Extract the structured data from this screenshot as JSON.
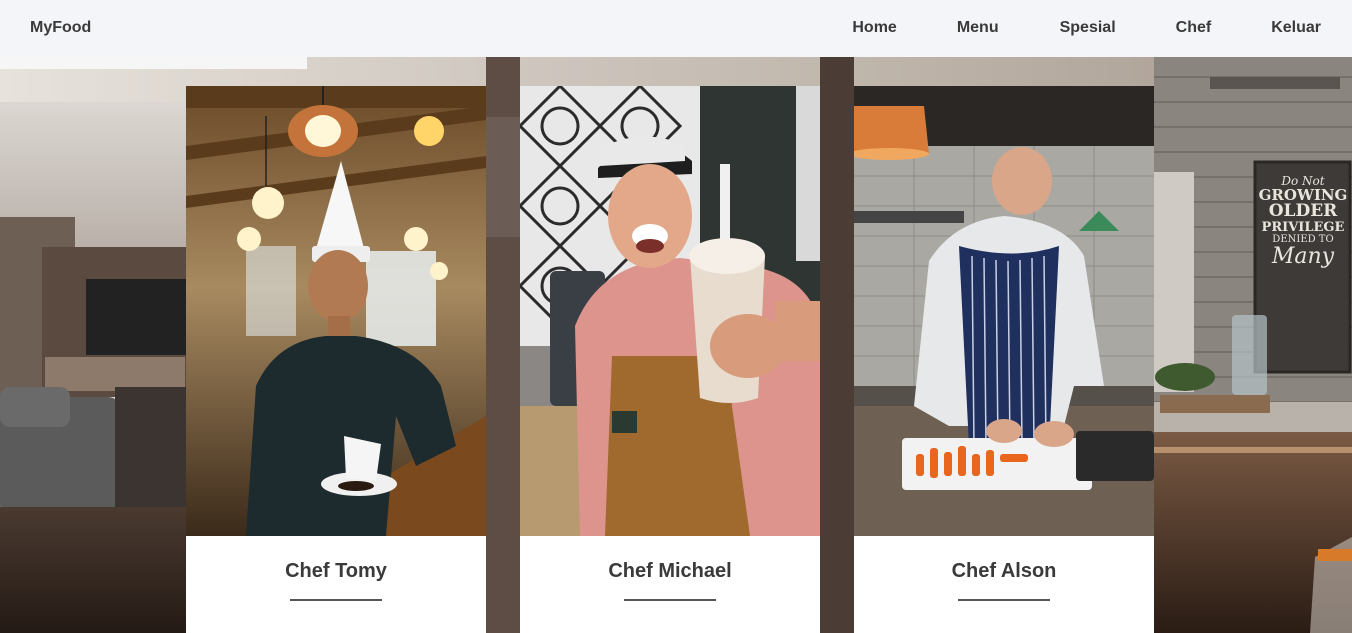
{
  "navbar": {
    "brand": "MyFood",
    "links": [
      "Home",
      "Menu",
      "Spesial",
      "Chef",
      "Keluar"
    ]
  },
  "background": {
    "sign_lines": [
      "Do Not",
      "GROWING",
      "OLDER",
      "PRIVILEGE",
      "DENIED TO",
      "Many"
    ]
  },
  "chefs": [
    {
      "name": "Chef Tomy"
    },
    {
      "name": "Chef Michael"
    },
    {
      "name": "Chef Alson"
    }
  ],
  "colors": {
    "navbar_bg": "#f4f5f8",
    "nav_text": "#3a3a3a",
    "card_bg": "#ffffff"
  }
}
